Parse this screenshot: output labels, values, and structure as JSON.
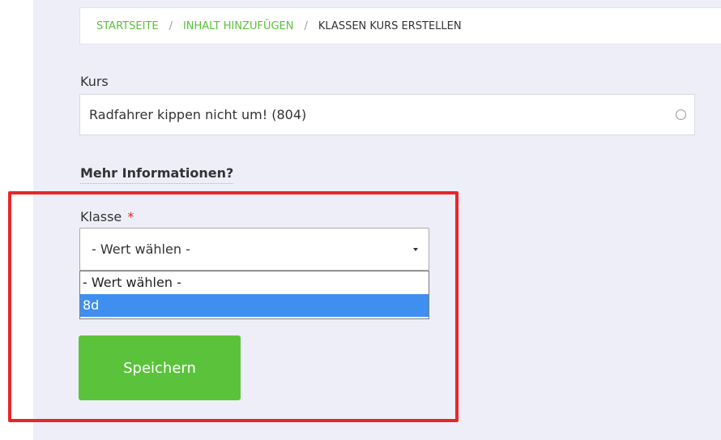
{
  "breadcrumb": {
    "items": [
      "STARTSEITE",
      "INHALT HINZUFÜGEN"
    ],
    "separator": "/",
    "current": "KLASSEN KURS ERSTELLEN"
  },
  "form": {
    "kurs_label": "Kurs",
    "kurs_value": "Radfahrer kippen nicht um! (804)",
    "more_info": "Mehr Informationen?",
    "klasse_label": "Klasse",
    "required_mark": "*",
    "select_value": "- Wert wählen -",
    "options": [
      "- Wert wählen -",
      "8d"
    ],
    "highlighted_option": "8d",
    "save_label": "Speichern"
  },
  "colors": {
    "accent_green": "#5cbf3a",
    "button_green": "#5bc33b",
    "highlight_red": "#e8262a",
    "selected_option_blue": "#3f8ff0",
    "page_background": "#eeeef8"
  }
}
